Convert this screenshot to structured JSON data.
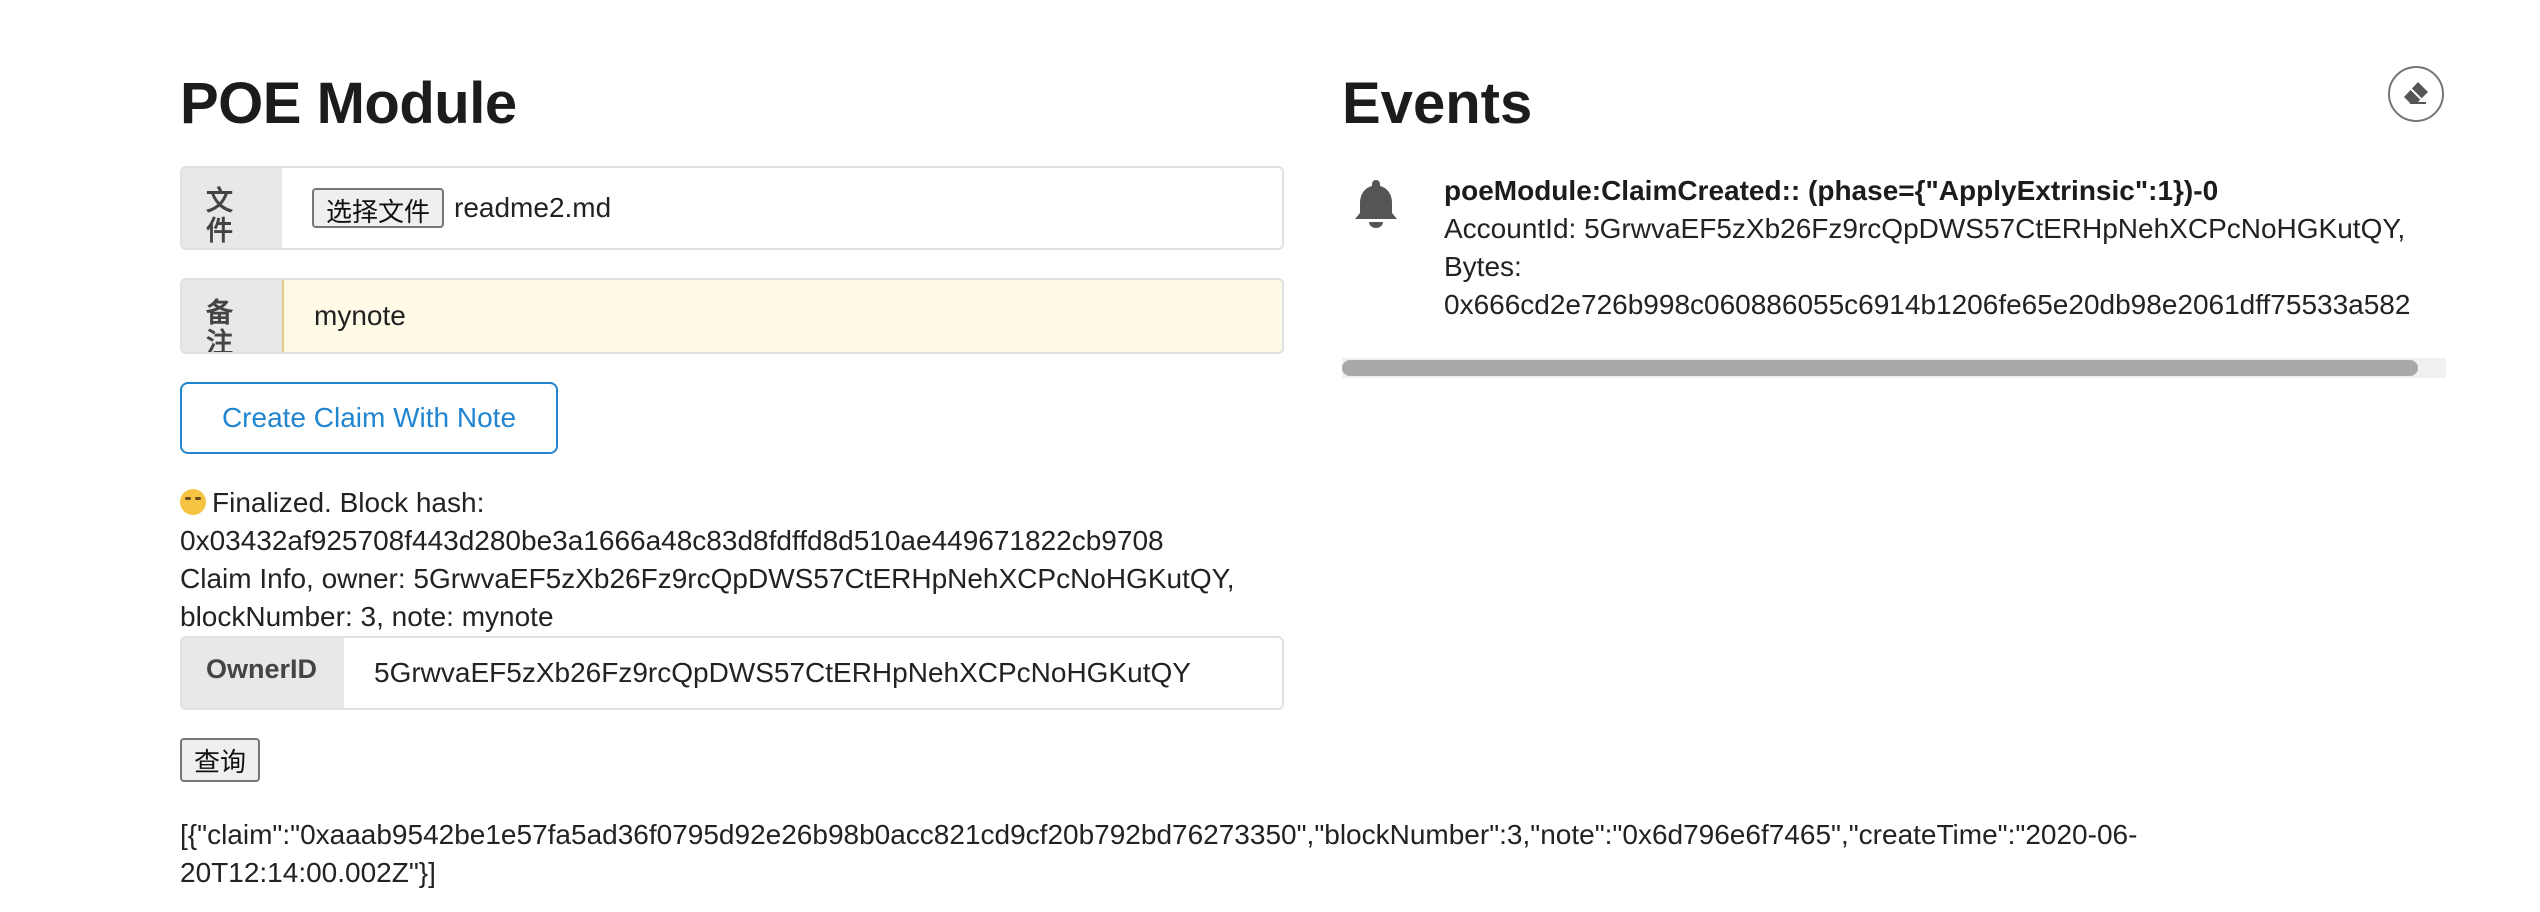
{
  "poe": {
    "title": "POE Module",
    "file_label": "文件",
    "file_button": "选择文件",
    "file_name": "readme2.md",
    "note_label": "备注",
    "note_value": "mynote",
    "create_button": "Create Claim With Note",
    "status_line1": "Finalized. Block hash:",
    "status_line2": "0x03432af925708f443d280be3a1666a48c83d8fdffd8d510ae449671822cb9708",
    "status_line3": "Claim Info, owner: 5GrwvaEF5zXb26Fz9rcQpDWS57CtERHpNehXCPcNoHGKutQY,",
    "status_line4": "blockNumber: 3, note: mynote",
    "owner_label": "OwnerID",
    "owner_value": "5GrwvaEF5zXb26Fz9rcQpDWS57CtERHpNehXCPcNoHGKutQY",
    "query_button": "查询",
    "result": "[{\"claim\":\"0xaaab9542be1e57fa5ad36f0795d92e26b98b0acc821cd9cf20b792bd76273350\",\"blockNumber\":3,\"note\":\"0x6d796e6f7465\",\"createTime\":\"2020-06-20T12:14:00.002Z\"}]"
  },
  "events": {
    "title": "Events",
    "clear_icon": "eraser-icon",
    "items": [
      {
        "icon": "bell-icon",
        "summary": "poeModule:ClaimCreated:: (phase={\"ApplyExtrinsic\":1})-0",
        "detail_line1": "AccountId: 5GrwvaEF5zXb26Fz9rcQpDWS57CtERHpNehXCPcNoHGKutQY,",
        "detail_line2": "Bytes:",
        "detail_line3": "0x666cd2e726b998c060886055c6914b1206fe65e20db98e2061dff75533a582"
      }
    ]
  },
  "colors": {
    "accent": "#2185d0",
    "note_bg": "#fffbe6",
    "label_bg": "#e8e8e8"
  }
}
